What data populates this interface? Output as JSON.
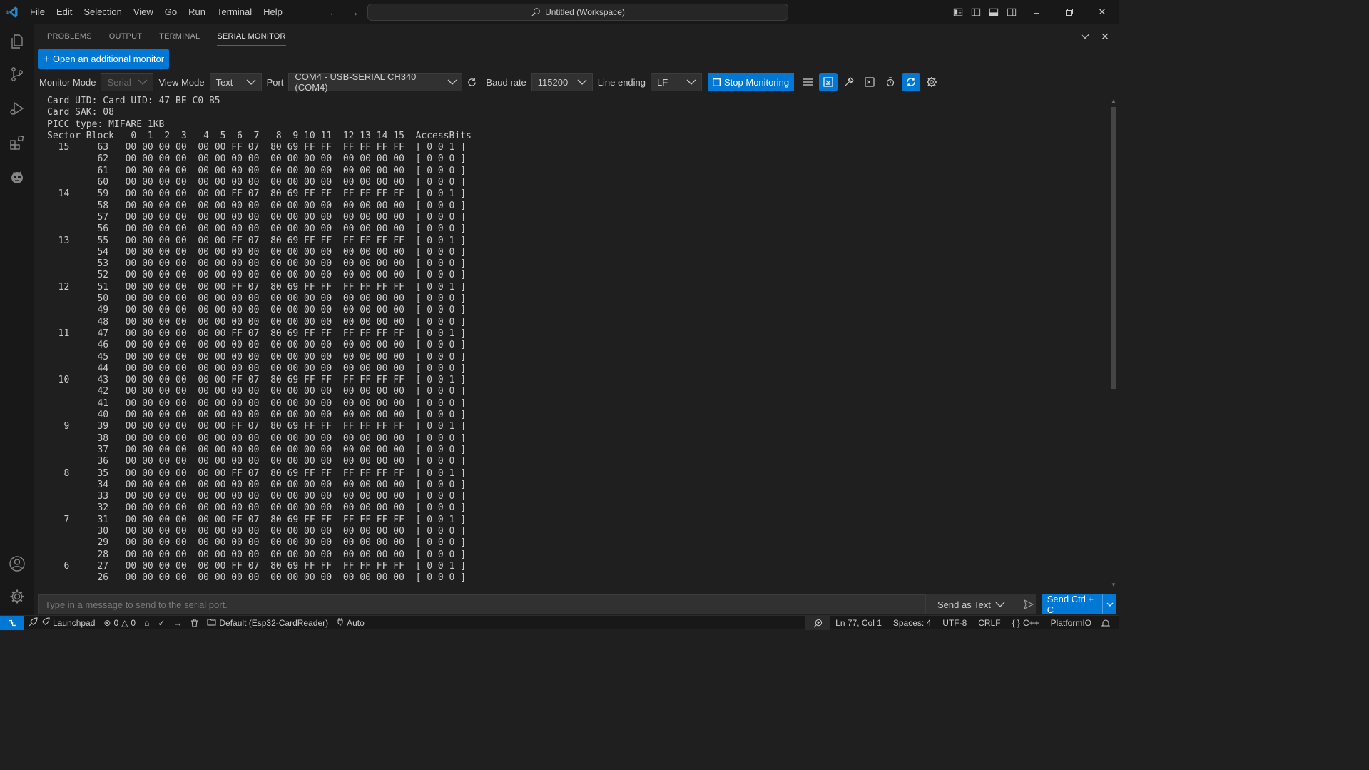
{
  "menu": [
    "File",
    "Edit",
    "Selection",
    "View",
    "Go",
    "Run",
    "Terminal",
    "Help"
  ],
  "command_center": "Untitled (Workspace)",
  "panel": {
    "tabs": [
      {
        "label": "PROBLEMS",
        "active": false
      },
      {
        "label": "OUTPUT",
        "active": false
      },
      {
        "label": "TERMINAL",
        "active": false
      },
      {
        "label": "SERIAL MONITOR",
        "active": true
      }
    ]
  },
  "serial_monitor": {
    "open_monitor_label": "Open an additional monitor",
    "monitor_mode_label": "Monitor Mode",
    "monitor_mode_value": "Serial",
    "view_mode_label": "View Mode",
    "view_mode_value": "Text",
    "port_label": "Port",
    "port_value": "COM4 - USB-SERIAL CH340 (COM4)",
    "baud_label": "Baud rate",
    "baud_value": "115200",
    "line_ending_label": "Line ending",
    "line_ending_value": "LF",
    "stop_label": "Stop Monitoring",
    "header_lines": [
      "Card UID: Card UID: 47 BE C0 B5",
      "Card SAK: 08",
      "PICC type: MIFARE 1KB",
      "Sector Block   0  1  2  3   4  5  6  7   8  9 10 11  12 13 14 15  AccessBits"
    ],
    "dump_rows": [
      {
        "sector": "15",
        "block": "63",
        "data": "00 00 00 00  00 00 FF 07  80 69 FF FF  FF FF FF FF",
        "access": "[ 0 0 1 ]"
      },
      {
        "sector": "",
        "block": "62",
        "data": "00 00 00 00  00 00 00 00  00 00 00 00  00 00 00 00",
        "access": "[ 0 0 0 ]"
      },
      {
        "sector": "",
        "block": "61",
        "data": "00 00 00 00  00 00 00 00  00 00 00 00  00 00 00 00",
        "access": "[ 0 0 0 ]"
      },
      {
        "sector": "",
        "block": "60",
        "data": "00 00 00 00  00 00 00 00  00 00 00 00  00 00 00 00",
        "access": "[ 0 0 0 ]"
      },
      {
        "sector": "14",
        "block": "59",
        "data": "00 00 00 00  00 00 FF 07  80 69 FF FF  FF FF FF FF",
        "access": "[ 0 0 1 ]"
      },
      {
        "sector": "",
        "block": "58",
        "data": "00 00 00 00  00 00 00 00  00 00 00 00  00 00 00 00",
        "access": "[ 0 0 0 ]"
      },
      {
        "sector": "",
        "block": "57",
        "data": "00 00 00 00  00 00 00 00  00 00 00 00  00 00 00 00",
        "access": "[ 0 0 0 ]"
      },
      {
        "sector": "",
        "block": "56",
        "data": "00 00 00 00  00 00 00 00  00 00 00 00  00 00 00 00",
        "access": "[ 0 0 0 ]"
      },
      {
        "sector": "13",
        "block": "55",
        "data": "00 00 00 00  00 00 FF 07  80 69 FF FF  FF FF FF FF",
        "access": "[ 0 0 1 ]"
      },
      {
        "sector": "",
        "block": "54",
        "data": "00 00 00 00  00 00 00 00  00 00 00 00  00 00 00 00",
        "access": "[ 0 0 0 ]"
      },
      {
        "sector": "",
        "block": "53",
        "data": "00 00 00 00  00 00 00 00  00 00 00 00  00 00 00 00",
        "access": "[ 0 0 0 ]"
      },
      {
        "sector": "",
        "block": "52",
        "data": "00 00 00 00  00 00 00 00  00 00 00 00  00 00 00 00",
        "access": "[ 0 0 0 ]"
      },
      {
        "sector": "12",
        "block": "51",
        "data": "00 00 00 00  00 00 FF 07  80 69 FF FF  FF FF FF FF",
        "access": "[ 0 0 1 ]"
      },
      {
        "sector": "",
        "block": "50",
        "data": "00 00 00 00  00 00 00 00  00 00 00 00  00 00 00 00",
        "access": "[ 0 0 0 ]"
      },
      {
        "sector": "",
        "block": "49",
        "data": "00 00 00 00  00 00 00 00  00 00 00 00  00 00 00 00",
        "access": "[ 0 0 0 ]"
      },
      {
        "sector": "",
        "block": "48",
        "data": "00 00 00 00  00 00 00 00  00 00 00 00  00 00 00 00",
        "access": "[ 0 0 0 ]"
      },
      {
        "sector": "11",
        "block": "47",
        "data": "00 00 00 00  00 00 FF 07  80 69 FF FF  FF FF FF FF",
        "access": "[ 0 0 1 ]"
      },
      {
        "sector": "",
        "block": "46",
        "data": "00 00 00 00  00 00 00 00  00 00 00 00  00 00 00 00",
        "access": "[ 0 0 0 ]"
      },
      {
        "sector": "",
        "block": "45",
        "data": "00 00 00 00  00 00 00 00  00 00 00 00  00 00 00 00",
        "access": "[ 0 0 0 ]"
      },
      {
        "sector": "",
        "block": "44",
        "data": "00 00 00 00  00 00 00 00  00 00 00 00  00 00 00 00",
        "access": "[ 0 0 0 ]"
      },
      {
        "sector": "10",
        "block": "43",
        "data": "00 00 00 00  00 00 FF 07  80 69 FF FF  FF FF FF FF",
        "access": "[ 0 0 1 ]"
      },
      {
        "sector": "",
        "block": "42",
        "data": "00 00 00 00  00 00 00 00  00 00 00 00  00 00 00 00",
        "access": "[ 0 0 0 ]"
      },
      {
        "sector": "",
        "block": "41",
        "data": "00 00 00 00  00 00 00 00  00 00 00 00  00 00 00 00",
        "access": "[ 0 0 0 ]"
      },
      {
        "sector": "",
        "block": "40",
        "data": "00 00 00 00  00 00 00 00  00 00 00 00  00 00 00 00",
        "access": "[ 0 0 0 ]"
      },
      {
        "sector": "9",
        "block": "39",
        "data": "00 00 00 00  00 00 FF 07  80 69 FF FF  FF FF FF FF",
        "access": "[ 0 0 1 ]"
      },
      {
        "sector": "",
        "block": "38",
        "data": "00 00 00 00  00 00 00 00  00 00 00 00  00 00 00 00",
        "access": "[ 0 0 0 ]"
      },
      {
        "sector": "",
        "block": "37",
        "data": "00 00 00 00  00 00 00 00  00 00 00 00  00 00 00 00",
        "access": "[ 0 0 0 ]"
      },
      {
        "sector": "",
        "block": "36",
        "data": "00 00 00 00  00 00 00 00  00 00 00 00  00 00 00 00",
        "access": "[ 0 0 0 ]"
      },
      {
        "sector": "8",
        "block": "35",
        "data": "00 00 00 00  00 00 FF 07  80 69 FF FF  FF FF FF FF",
        "access": "[ 0 0 1 ]"
      },
      {
        "sector": "",
        "block": "34",
        "data": "00 00 00 00  00 00 00 00  00 00 00 00  00 00 00 00",
        "access": "[ 0 0 0 ]"
      },
      {
        "sector": "",
        "block": "33",
        "data": "00 00 00 00  00 00 00 00  00 00 00 00  00 00 00 00",
        "access": "[ 0 0 0 ]"
      },
      {
        "sector": "",
        "block": "32",
        "data": "00 00 00 00  00 00 00 00  00 00 00 00  00 00 00 00",
        "access": "[ 0 0 0 ]"
      },
      {
        "sector": "7",
        "block": "31",
        "data": "00 00 00 00  00 00 FF 07  80 69 FF FF  FF FF FF FF",
        "access": "[ 0 0 1 ]"
      },
      {
        "sector": "",
        "block": "30",
        "data": "00 00 00 00  00 00 00 00  00 00 00 00  00 00 00 00",
        "access": "[ 0 0 0 ]"
      },
      {
        "sector": "",
        "block": "29",
        "data": "00 00 00 00  00 00 00 00  00 00 00 00  00 00 00 00",
        "access": "[ 0 0 0 ]"
      },
      {
        "sector": "",
        "block": "28",
        "data": "00 00 00 00  00 00 00 00  00 00 00 00  00 00 00 00",
        "access": "[ 0 0 0 ]"
      },
      {
        "sector": "6",
        "block": "27",
        "data": "00 00 00 00  00 00 FF 07  80 69 FF FF  FF FF FF FF",
        "access": "[ 0 0 1 ]"
      },
      {
        "sector": "",
        "block": "26",
        "data": "00 00 00 00  00 00 00 00  00 00 00 00  00 00 00 00",
        "access": "[ 0 0 0 ]"
      }
    ],
    "send_placeholder": "Type in a message to send to the serial port.",
    "send_mode": "Send as Text",
    "send_button": "Send Ctrl + C"
  },
  "statusbar": {
    "launchpad": "Launchpad",
    "errors": "0",
    "warnings": "0",
    "env": "Default (Esp32-CardReader)",
    "auto": "Auto",
    "position": "Ln 77, Col 1",
    "spaces": "Spaces: 4",
    "encoding": "UTF-8",
    "eol": "CRLF",
    "language": "C++",
    "platformio": "PlatformIO"
  },
  "colors": {
    "accent": "#0078d4",
    "background": "#1f1f1f",
    "chrome": "#181818"
  }
}
